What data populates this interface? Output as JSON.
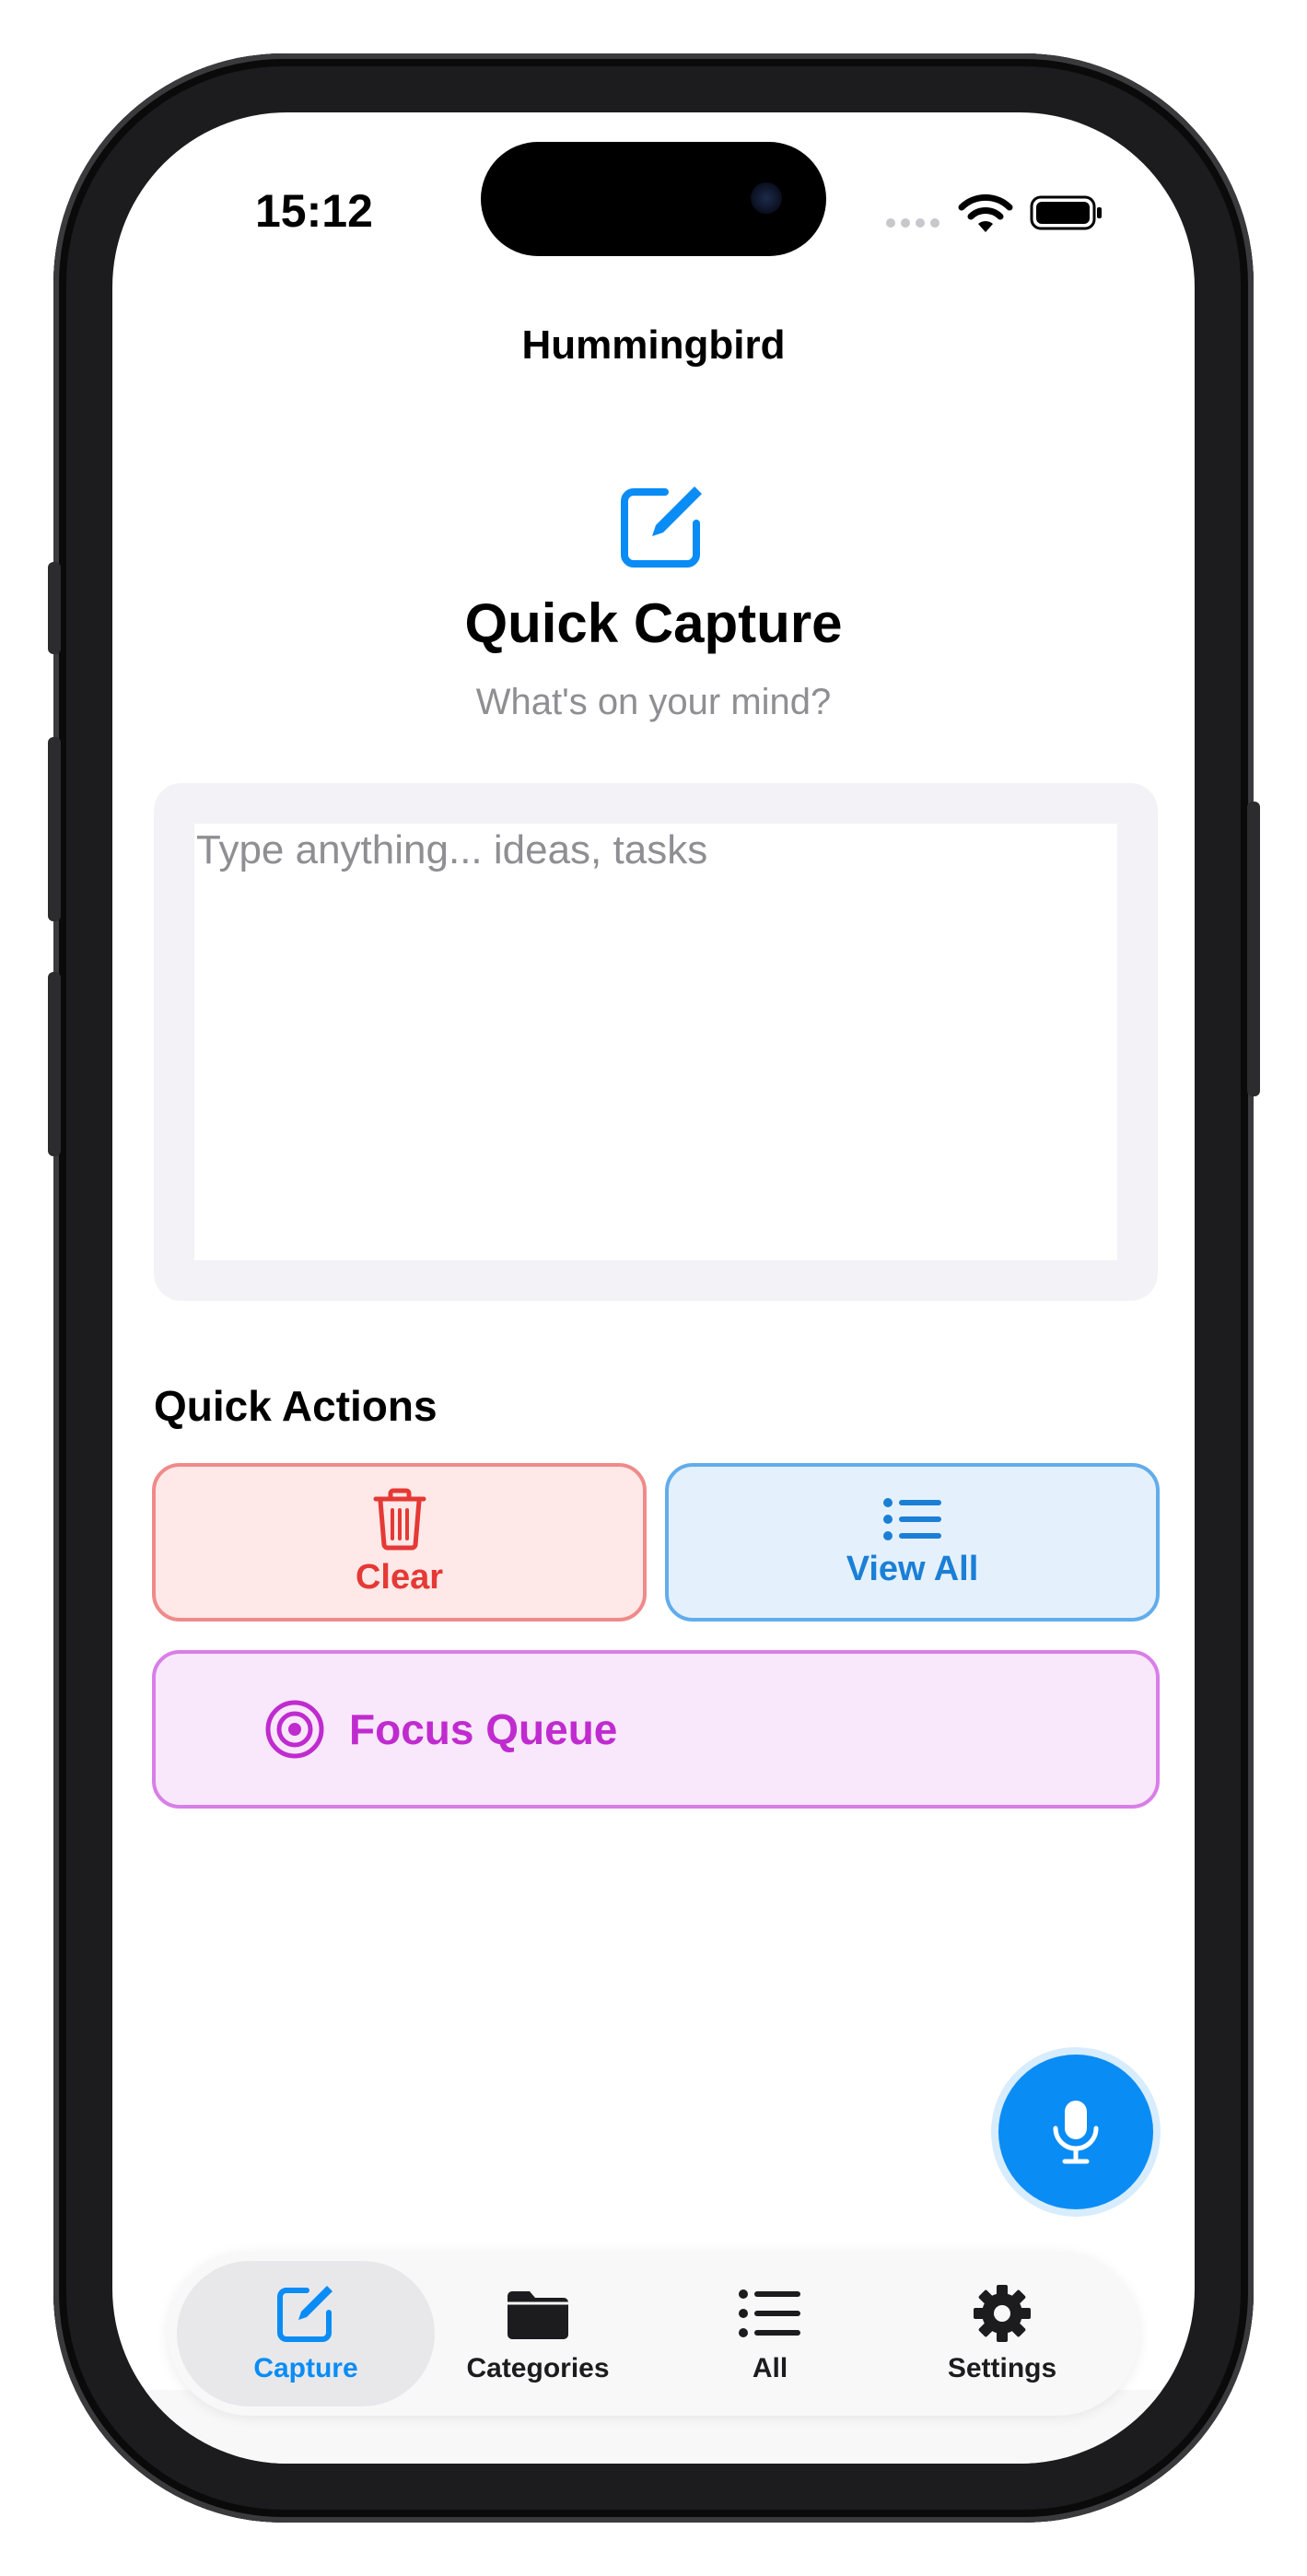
{
  "status_bar": {
    "time": "15:12"
  },
  "header": {
    "title": "Hummingbird"
  },
  "hero": {
    "icon": "square-pencil-icon",
    "title": "Quick Capture",
    "subtitle": "What's on your mind?"
  },
  "capture_input": {
    "placeholder": "Type anything... ideas, tasks",
    "value": ""
  },
  "quick_actions": {
    "title": "Quick Actions",
    "clear": {
      "label": "Clear",
      "icon": "trash-icon",
      "color": "#e53935"
    },
    "view_all": {
      "label": "View All",
      "icon": "list-icon",
      "color": "#1b7fd6"
    },
    "focus_queue": {
      "label": "Focus Queue",
      "icon": "target-icon",
      "color": "#c02bcf"
    }
  },
  "mic_button": {
    "icon": "microphone-icon",
    "color": "#0a8cf5"
  },
  "tab_bar": {
    "tabs": [
      {
        "label": "Capture",
        "icon": "square-pencil-icon",
        "active": true
      },
      {
        "label": "Categories",
        "icon": "folder-icon",
        "active": false
      },
      {
        "label": "All",
        "icon": "list-icon",
        "active": false
      },
      {
        "label": "Settings",
        "icon": "gear-icon",
        "active": false
      }
    ],
    "accent": "#0a8cf5"
  }
}
